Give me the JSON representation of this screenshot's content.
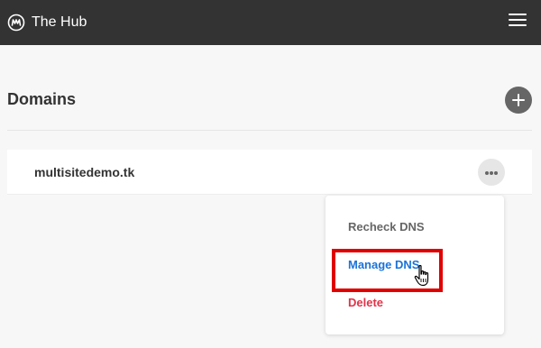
{
  "header": {
    "app_title": "The Hub",
    "logo_icon": "the-hub-logo",
    "menu_icon": "hamburger-menu-icon",
    "background": "#333333"
  },
  "main": {
    "section_title": "Domains",
    "add_icon": "plus-icon"
  },
  "domains": [
    {
      "name": "multisitedemo.tk",
      "actions_icon": "more-horizontal-icon"
    }
  ],
  "dropdown": {
    "items": [
      {
        "label": "Recheck DNS",
        "color": "#666666"
      },
      {
        "label": "Manage DNS",
        "color": "#1a73d9"
      },
      {
        "label": "Delete",
        "color": "#e0334a"
      }
    ]
  },
  "annotation": {
    "highlight_color": "#e00000",
    "cursor_icon": "hand-pointer-icon"
  }
}
